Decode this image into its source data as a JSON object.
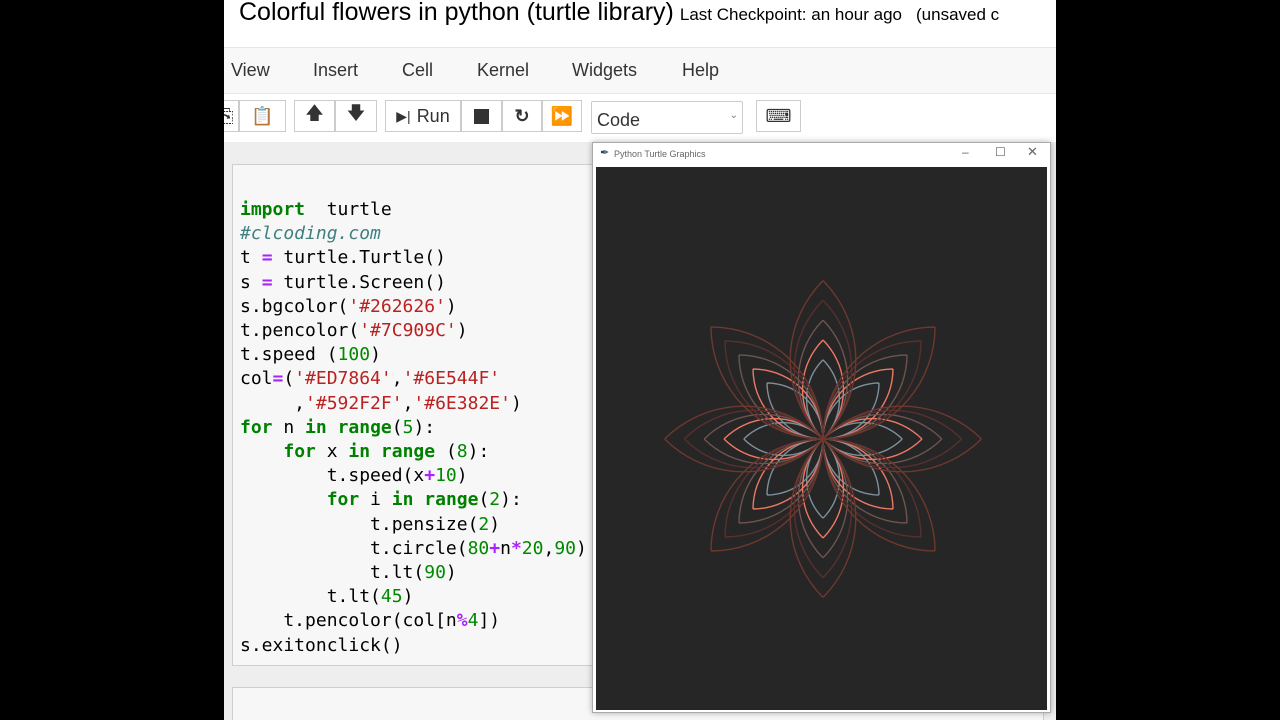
{
  "header": {
    "title": "Colorful flowers in python (turtle library)",
    "checkpoint": "Last Checkpoint: an hour ago",
    "unsaved": "(unsaved c"
  },
  "menu": [
    "View",
    "Insert",
    "Cell",
    "Kernel",
    "Widgets",
    "Help"
  ],
  "toolbar": {
    "run_label": "Run",
    "cell_type": "Code"
  },
  "turtle_window": {
    "title": "Python Turtle Graphics",
    "bgcolor": "#262626",
    "pencolor": "#7C909C",
    "colors": [
      "#ED7864",
      "#6E544F",
      "#592F2F",
      "#6E382E"
    ]
  },
  "code": [
    [
      [
        "kw",
        "import"
      ],
      [
        "",
        "  turtle"
      ]
    ],
    [
      [
        "cm",
        "#clcoding.com"
      ]
    ],
    [
      [
        "",
        "t "
      ],
      [
        "op",
        "="
      ],
      [
        "",
        " turtle.Turtle()"
      ]
    ],
    [
      [
        "",
        "s "
      ],
      [
        "op",
        "="
      ],
      [
        "",
        " turtle.Screen()"
      ]
    ],
    [
      [
        "",
        "s.bgcolor("
      ],
      [
        "st",
        "'#262626'"
      ],
      [
        "",
        ")"
      ]
    ],
    [
      [
        "",
        "t.pencolor("
      ],
      [
        "st",
        "'#7C909C'"
      ],
      [
        "",
        ")"
      ]
    ],
    [
      [
        "",
        "t.speed ("
      ],
      [
        "nu",
        "100"
      ],
      [
        "",
        ")"
      ]
    ],
    [
      [
        "",
        "col"
      ],
      [
        "op",
        "="
      ],
      [
        "",
        "("
      ],
      [
        "st",
        "'#ED7864'"
      ],
      [
        "",
        ","
      ],
      [
        "st",
        "'#6E544F'"
      ]
    ],
    [
      [
        "",
        "     ,"
      ],
      [
        "st",
        "'#592F2F'"
      ],
      [
        "",
        ","
      ],
      [
        "st",
        "'#6E382E'"
      ],
      [
        "",
        ")"
      ]
    ],
    [
      [
        "kw",
        "for"
      ],
      [
        "",
        " n "
      ],
      [
        "kw",
        "in"
      ],
      [
        "",
        " "
      ],
      [
        "kw",
        "range"
      ],
      [
        "",
        "("
      ],
      [
        "nu",
        "5"
      ],
      [
        "",
        "):"
      ]
    ],
    [
      [
        "",
        "    "
      ],
      [
        "kw",
        "for"
      ],
      [
        "",
        " x "
      ],
      [
        "kw",
        "in"
      ],
      [
        "",
        " "
      ],
      [
        "kw",
        "range"
      ],
      [
        "",
        " ("
      ],
      [
        "nu",
        "8"
      ],
      [
        "",
        "):"
      ]
    ],
    [
      [
        "",
        "        t.speed(x"
      ],
      [
        "op",
        "+"
      ],
      [
        "nu",
        "10"
      ],
      [
        "",
        ")"
      ]
    ],
    [
      [
        "",
        "        "
      ],
      [
        "kw",
        "for"
      ],
      [
        "",
        " i "
      ],
      [
        "kw",
        "in"
      ],
      [
        "",
        " "
      ],
      [
        "kw",
        "range"
      ],
      [
        "",
        "("
      ],
      [
        "nu",
        "2"
      ],
      [
        "",
        "):"
      ]
    ],
    [
      [
        "",
        "            t.pensize("
      ],
      [
        "nu",
        "2"
      ],
      [
        "",
        ")"
      ]
    ],
    [
      [
        "",
        "            t.circle("
      ],
      [
        "nu",
        "80"
      ],
      [
        "op",
        "+"
      ],
      [
        "",
        "n"
      ],
      [
        "op",
        "*"
      ],
      [
        "nu",
        "20"
      ],
      [
        "",
        ","
      ],
      [
        "nu",
        "90"
      ],
      [
        "",
        ")"
      ]
    ],
    [
      [
        "",
        "            t.lt("
      ],
      [
        "nu",
        "90"
      ],
      [
        "",
        ")"
      ]
    ],
    [
      [
        "",
        "        t.lt("
      ],
      [
        "nu",
        "45"
      ],
      [
        "",
        ")"
      ]
    ],
    [
      [
        "",
        "    t.pencolor(col[n"
      ],
      [
        "op",
        "%"
      ],
      [
        "nu",
        "4"
      ],
      [
        "",
        "])"
      ]
    ],
    [
      [
        "",
        "s.exitonclick()"
      ]
    ]
  ]
}
